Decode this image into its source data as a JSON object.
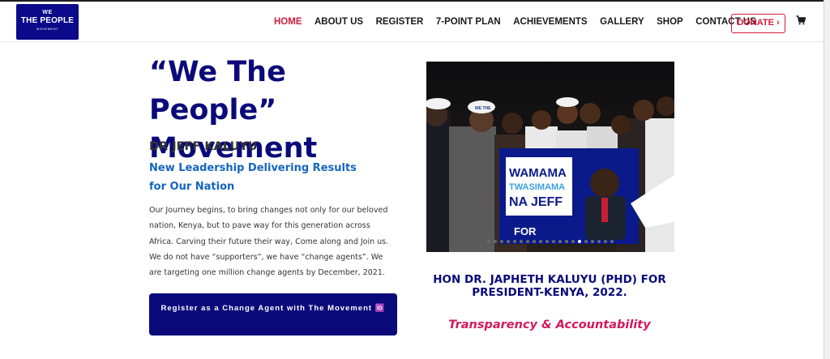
{
  "logo": {
    "line1": "WE",
    "line2": "THE PEOPLE",
    "line3": "MOVEMENT"
  },
  "nav": {
    "items": [
      "HOME",
      "ABOUT US",
      "REGISTER",
      "7-POINT PLAN",
      "ACHIEVEMENTS",
      "GALLERY",
      "SHOP",
      "CONTACT US"
    ],
    "active": "HOME",
    "donate_label": "DONATE ›",
    "cart_icon": "cart-icon"
  },
  "hero": {
    "headline_line1": "“We The People”",
    "headline_line2": "Movement",
    "subhead": "DR JEFF KALUYU",
    "tagline": "New Leadership Delivering Results for Our Nation",
    "paragraphs": [
      "Our Journey begins, to bring changes not only for our beloved nation, Kenya, but to pave way for this generation across Africa. Carving their future their way, Come along and Join us.",
      "We do not have “supporters”, we have “change agents”. We are targeting one million change agents by December, 2021."
    ],
    "cta_label": "Register as a Change Agent with The Movement 🆔"
  },
  "photo": {
    "banner_line1": "WAMAMA",
    "banner_line2": "TWASIMAMA",
    "banner_line3": "NA JEFF",
    "banner_footer": "FOR",
    "cap_text": "WE THE",
    "slide_count": 20,
    "active_slide_index": 14
  },
  "caption": "HON DR. JAPHETH KALUYU (PHD) FOR PRESIDENT-KENYA, 2022.",
  "motto": "Transparency & Accountability",
  "colors": {
    "brand_blue": "#0a0a7a",
    "accent_red": "#d11a3a",
    "link_blue": "#1565c0",
    "motto_pink": "#d11a5a"
  }
}
